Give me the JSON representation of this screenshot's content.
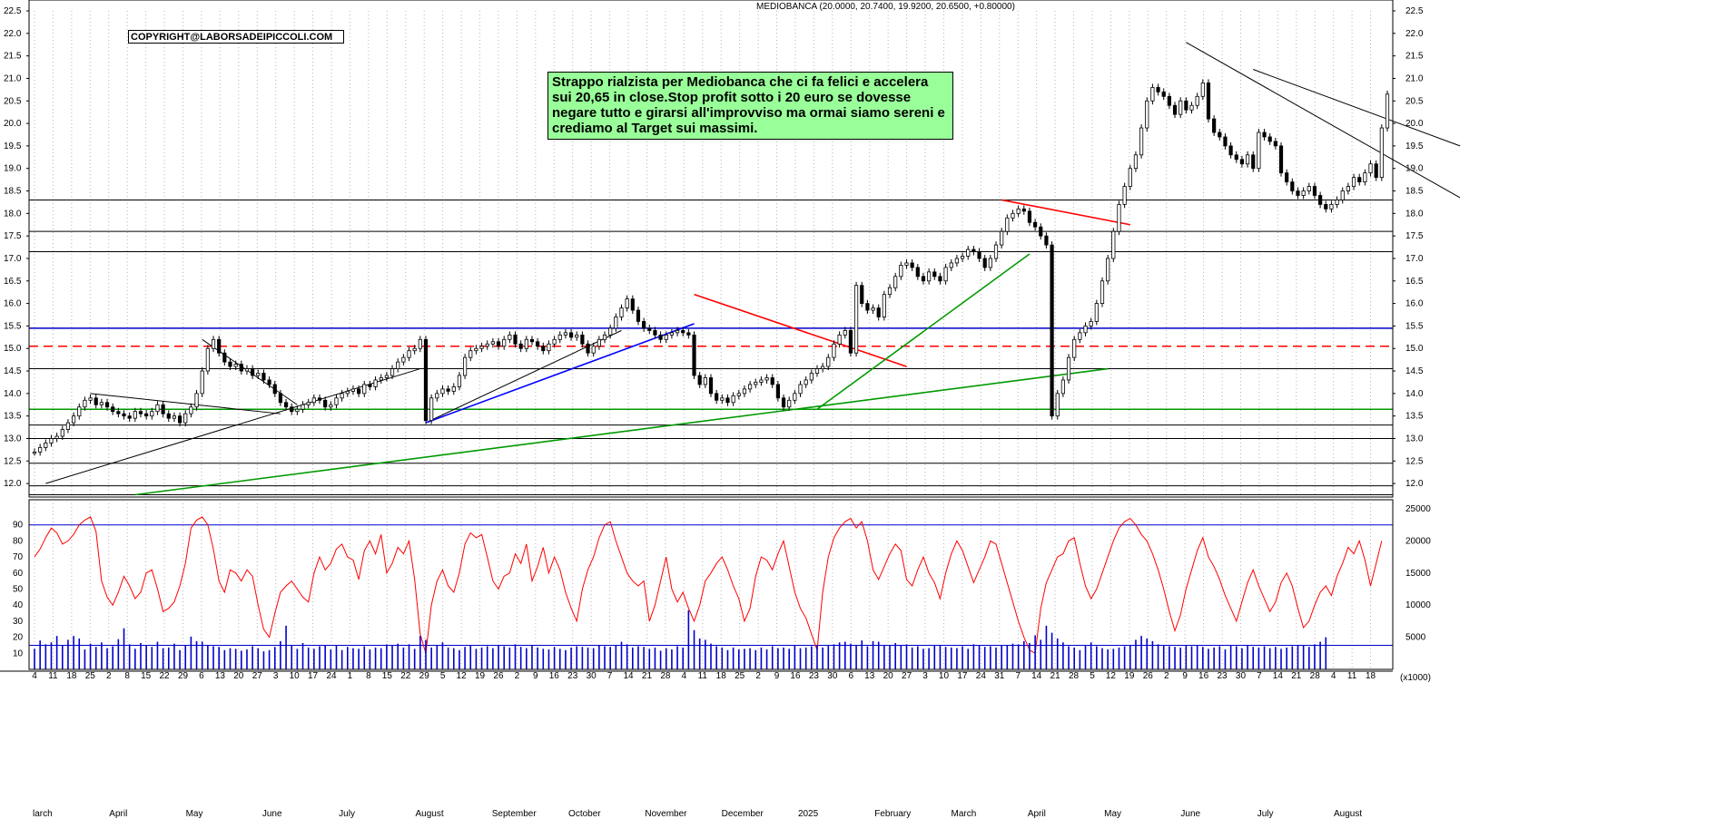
{
  "chart_data": [
    {
      "type": "candlestick",
      "title": "MEDIOBANCA (20.0000, 20.7400, 19.9200, 20.6500, +0.80000)",
      "copyright": "COPYRIGHT@LABORSADEIPICCOLI.COM",
      "annotation": "Strappo rialzista per Mediobanca che ci fa felici e accelera sui 20,65 in close.Stop profit sotto i 20 euro se dovesse negare tutto e girarsi all'improvviso ma ormai siamo sereni e crediamo al  Target sui massimi.",
      "ylim": [
        11.7,
        22.5
      ],
      "y_ticks": [
        "12.0",
        "12.5",
        "13.0",
        "13.5",
        "14.0",
        "14.5",
        "15.0",
        "15.5",
        "16.0",
        "16.5",
        "17.0",
        "17.5",
        "18.0",
        "18.5",
        "19.0",
        "19.5",
        "20.0",
        "20.5",
        "21.0",
        "21.5",
        "22.0",
        "22.5"
      ],
      "grid": "vertical dotted",
      "series": [
        {
          "values": [
            12.7,
            12.8,
            12.9,
            13.0,
            13.05,
            13.2,
            13.35,
            13.5,
            13.7,
            13.85,
            13.9,
            13.75,
            13.8,
            13.7,
            13.6,
            13.55,
            13.5,
            13.45,
            13.6,
            13.55,
            13.5,
            13.6,
            13.75,
            13.55,
            13.45,
            13.5,
            13.35,
            13.55,
            13.7,
            14.0,
            14.5,
            15.0,
            15.2,
            14.9,
            14.7,
            14.6,
            14.65,
            14.5,
            14.55,
            14.4,
            14.45,
            14.3,
            14.2,
            14.0,
            13.8,
            13.7,
            13.6,
            13.65,
            13.75,
            13.8,
            13.9,
            13.85,
            13.7,
            13.75,
            13.9,
            14.0,
            14.05,
            14.1,
            14.0,
            14.2,
            14.15,
            14.3,
            14.35,
            14.4,
            14.55,
            14.7,
            14.8,
            14.95,
            15.0,
            15.2,
            13.4,
            13.9,
            14.0,
            14.1,
            14.05,
            14.15,
            14.4,
            14.8,
            14.95,
            15.0,
            15.05,
            15.1,
            15.15,
            15.05,
            15.2,
            15.3,
            15.1,
            15.0,
            15.2,
            15.15,
            15.05,
            14.95,
            15.1,
            15.2,
            15.3,
            15.35,
            15.25,
            15.3,
            15.1,
            14.9,
            15.05,
            15.2,
            15.3,
            15.45,
            15.7,
            15.9,
            16.1,
            15.85,
            15.6,
            15.45,
            15.4,
            15.3,
            15.2,
            15.3,
            15.35,
            15.4,
            15.35,
            15.3,
            14.4,
            14.2,
            14.35,
            14.0,
            13.85,
            13.9,
            13.8,
            13.95,
            14.0,
            14.1,
            14.2,
            14.25,
            14.3,
            14.35,
            14.2,
            13.9,
            13.7,
            13.85,
            14.0,
            14.2,
            14.3,
            14.45,
            14.55,
            14.6,
            14.8,
            15.1,
            15.3,
            15.4,
            14.9,
            16.4,
            16.0,
            15.85,
            15.9,
            15.7,
            16.2,
            16.35,
            16.6,
            16.85,
            16.9,
            16.8,
            16.6,
            16.5,
            16.7,
            16.6,
            16.5,
            16.8,
            16.9,
            17.0,
            17.05,
            17.2,
            17.15,
            17.0,
            16.8,
            17.0,
            17.3,
            17.6,
            17.9,
            18.0,
            18.1,
            18.05,
            17.8,
            17.7,
            17.5,
            17.3,
            13.5,
            14.0,
            14.3,
            14.8,
            15.2,
            15.35,
            15.5,
            15.6,
            16.0,
            16.5,
            17.0,
            17.6,
            18.2,
            18.6,
            19.0,
            19.3,
            19.9,
            20.5,
            20.8,
            20.7,
            20.6,
            20.4,
            20.2,
            20.5,
            20.3,
            20.4,
            20.6,
            20.9,
            20.1,
            19.8,
            19.7,
            19.5,
            19.3,
            19.2,
            19.1,
            19.3,
            19.0,
            19.8,
            19.7,
            19.6,
            19.5,
            18.9,
            18.7,
            18.5,
            18.4,
            18.5,
            18.6,
            18.4,
            18.2,
            18.1,
            18.2,
            18.3,
            18.5,
            18.6,
            18.8,
            18.7,
            18.9,
            19.1,
            18.8,
            19.9,
            20.65
          ]
        },
        {
          "name": "Oscillator",
          "values": [
            70,
            75,
            82,
            88,
            85,
            78,
            80,
            84,
            90,
            93,
            95,
            86,
            55,
            45,
            40,
            48,
            58,
            52,
            44,
            48,
            60,
            62,
            50,
            36,
            38,
            42,
            52,
            66,
            88,
            93,
            95,
            90,
            75,
            55,
            48,
            62,
            60,
            55,
            62,
            58,
            40,
            25,
            20,
            35,
            48,
            52,
            55,
            50,
            45,
            42,
            60,
            70,
            62,
            66,
            75,
            78,
            70,
            68,
            56,
            74,
            80,
            72,
            84,
            60,
            66,
            76,
            72,
            80,
            56,
            22,
            10,
            40,
            55,
            62,
            52,
            48,
            60,
            78,
            85,
            82,
            84,
            70,
            55,
            50,
            58,
            60,
            72,
            66,
            78,
            55,
            64,
            76,
            60,
            70,
            62,
            48,
            38,
            30,
            50,
            62,
            70,
            82,
            90,
            92,
            80,
            70,
            60,
            55,
            52,
            55,
            30,
            40,
            55,
            70,
            50,
            42,
            48,
            38,
            30,
            40,
            55,
            60,
            66,
            70,
            62,
            52,
            44,
            30,
            38,
            58,
            70,
            68,
            62,
            72,
            80,
            64,
            48,
            38,
            32,
            22,
            12,
            48,
            70,
            82,
            88,
            92,
            94,
            88,
            92,
            80,
            62,
            56,
            64,
            72,
            78,
            74,
            56,
            52,
            62,
            70,
            60,
            54,
            44,
            60,
            72,
            80,
            74,
            64,
            54,
            62,
            70,
            80,
            78,
            66,
            54,
            42,
            30,
            20,
            12,
            10,
            38,
            54,
            62,
            70,
            72,
            80,
            82,
            66,
            52,
            44,
            50,
            60,
            70,
            80,
            88,
            92,
            94,
            90,
            84,
            80,
            72,
            62,
            50,
            36,
            24,
            34,
            50,
            62,
            74,
            82,
            70,
            64,
            56,
            46,
            38,
            30,
            42,
            54,
            62,
            52,
            44,
            36,
            42,
            54,
            60,
            52,
            38,
            26,
            30,
            40,
            48,
            52,
            46,
            58,
            66,
            76,
            72,
            80,
            68,
            52,
            66,
            80
          ]
        },
        {
          "name": "Volume",
          "values": [
            3200,
            4500,
            3900,
            4200,
            5200,
            3700,
            4600,
            5200,
            4800,
            3100,
            4000,
            3500,
            4200,
            3300,
            3600,
            4700,
            6400,
            3900,
            3200,
            4100,
            3700,
            3500,
            4300,
            3300,
            3400,
            4000,
            3000,
            3800,
            5100,
            4400,
            4300,
            3800,
            3600,
            3500,
            3000,
            3300,
            3200,
            2900,
            3100,
            3600,
            3300,
            2800,
            3000,
            3500,
            4400,
            6800,
            3700,
            3200,
            4100,
            3400,
            3200,
            3600,
            3800,
            3100,
            3700,
            3000,
            3500,
            3300,
            3200,
            3600,
            3100,
            3400,
            3300,
            3900,
            3700,
            4000,
            3400,
            3900,
            3200,
            5200,
            4600,
            3400,
            3700,
            4200,
            3400,
            3300,
            3000,
            3500,
            3700,
            3200,
            3400,
            3600,
            3300,
            3700,
            3600,
            3400,
            3900,
            3500,
            3300,
            3800,
            3400,
            3200,
            3100,
            3500,
            3200,
            3000,
            3400,
            3600,
            3500,
            3400,
            3300,
            3700,
            3600,
            3500,
            3700,
            4300,
            3900,
            3400,
            3600,
            3500,
            3200,
            3400,
            2900,
            3300,
            3100,
            3600,
            3400,
            9200,
            6100,
            4800,
            4600,
            4000,
            3600,
            3400,
            3000,
            3400,
            3100,
            3200,
            3300,
            3000,
            3400,
            3100,
            3600,
            3300,
            3400,
            3200,
            3800,
            3300,
            3400,
            3600,
            3700,
            3400,
            3800,
            3900,
            4200,
            4300,
            4000,
            3800,
            4500,
            3600,
            4400,
            4300,
            3700,
            3800,
            4100,
            3800,
            3900,
            3400,
            3600,
            3200,
            3300,
            3800,
            3700,
            3500,
            3400,
            3300,
            3600,
            3200,
            3900,
            3700,
            3500,
            3600,
            3400,
            3800,
            3700,
            4000,
            3900,
            4400,
            4100,
            5300,
            4600,
            6800,
            5700,
            4800,
            4200,
            3600,
            3400,
            3000,
            3800,
            4200,
            3600,
            3300,
            3100,
            3200,
            3400,
            3600,
            3700,
            4600,
            5200,
            4800,
            4400,
            3900,
            3800,
            3600,
            3500,
            3400,
            3700,
            3600,
            3800,
            3500,
            3200,
            3400,
            3600,
            3100,
            3800,
            3600,
            3300,
            3700,
            3500,
            3400,
            3600,
            3300,
            3500,
            3200,
            3400,
            3600,
            3800,
            3700,
            3500,
            3900,
            4300,
            5000
          ]
        }
      ],
      "oscillator": {
        "ylim": [
          0,
          100
        ],
        "y_ticks": [
          "10",
          "20",
          "30",
          "40",
          "50",
          "60",
          "70",
          "80",
          "90"
        ],
        "reference_lines": [
          90,
          15
        ]
      },
      "volume": {
        "ylim": [
          0,
          25000
        ],
        "y_ticks": [
          "5000",
          "10000",
          "15000",
          "20000",
          "25000"
        ],
        "unit_label": "(x1000)"
      },
      "x_axis": {
        "day_ticks": [
          "4",
          "11",
          "18",
          "25",
          "2",
          "8",
          "15",
          "22",
          "29",
          "6",
          "13",
          "20",
          "27",
          "3",
          "10",
          "17",
          "24",
          "1",
          "8",
          "15",
          "22",
          "29",
          "5",
          "12",
          "19",
          "26",
          "2",
          "9",
          "16",
          "23",
          "30",
          "7",
          "14",
          "21",
          "28",
          "4",
          "11",
          "18",
          "25",
          "2",
          "9",
          "16",
          "23",
          "30",
          "6",
          "13",
          "20",
          "27",
          "3",
          "10",
          "17",
          "24",
          "31",
          "7",
          "14",
          "21",
          "28",
          "5",
          "12",
          "19",
          "26",
          "2",
          "9",
          "16",
          "23",
          "30",
          "7",
          "14",
          "21",
          "28",
          "4",
          "11",
          "18"
        ],
        "month_labels": [
          "larch",
          "April",
          "May",
          "June",
          "July",
          "August",
          "September",
          "October",
          "November",
          "December",
          "2025",
          "February",
          "March",
          "April",
          "May",
          "June",
          "July",
          "August"
        ]
      },
      "horizontal_levels": [
        {
          "value": 15.45,
          "color": "#0000cc"
        },
        {
          "value": 15.05,
          "color": "#ff0000",
          "style": "dashed"
        },
        {
          "value": 14.55,
          "color": "#000000"
        },
        {
          "value": 13.65,
          "color": "#009900"
        },
        {
          "value": 13.3,
          "color": "#000000"
        },
        {
          "value": 13.0,
          "color": "#000000"
        },
        {
          "value": 12.45,
          "color": "#000000"
        },
        {
          "value": 11.95,
          "color": "#000000"
        },
        {
          "value": 11.75,
          "color": "#000000"
        },
        {
          "value": 17.15,
          "color": "#000000"
        },
        {
          "value": 18.3,
          "color": "#000000"
        },
        {
          "value": 17.6,
          "color": "#000000"
        }
      ],
      "colors": {
        "price": "#000000",
        "oscillator": "#ff0000",
        "volume": "#0000cc",
        "support": "#009900",
        "resistance": "#ff0000",
        "annotation_bg": "#99ff99"
      }
    }
  ]
}
